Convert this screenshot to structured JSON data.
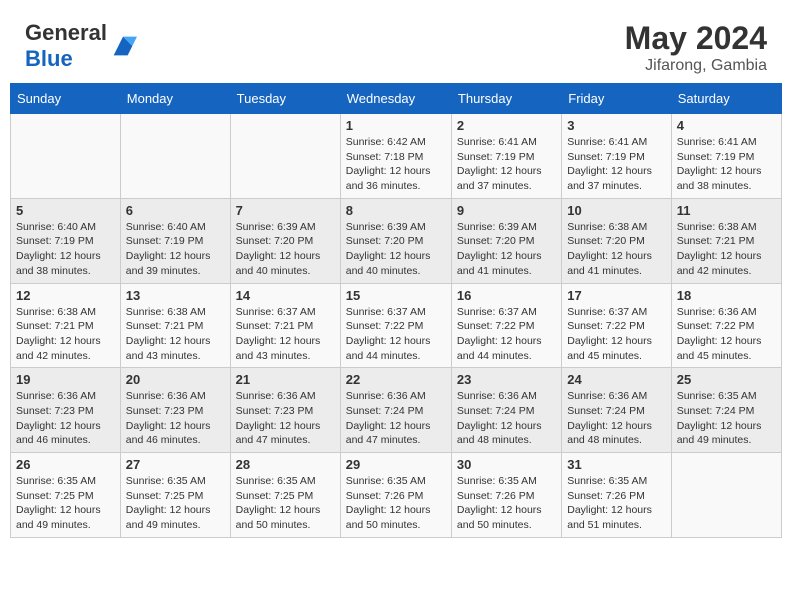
{
  "header": {
    "logo_general": "General",
    "logo_blue": "Blue",
    "month_year": "May 2024",
    "location": "Jifarong, Gambia"
  },
  "days_of_week": [
    "Sunday",
    "Monday",
    "Tuesday",
    "Wednesday",
    "Thursday",
    "Friday",
    "Saturday"
  ],
  "weeks": [
    [
      {
        "day": "",
        "info": ""
      },
      {
        "day": "",
        "info": ""
      },
      {
        "day": "",
        "info": ""
      },
      {
        "day": "1",
        "info": "Sunrise: 6:42 AM\nSunset: 7:18 PM\nDaylight: 12 hours and 36 minutes."
      },
      {
        "day": "2",
        "info": "Sunrise: 6:41 AM\nSunset: 7:19 PM\nDaylight: 12 hours and 37 minutes."
      },
      {
        "day": "3",
        "info": "Sunrise: 6:41 AM\nSunset: 7:19 PM\nDaylight: 12 hours and 37 minutes."
      },
      {
        "day": "4",
        "info": "Sunrise: 6:41 AM\nSunset: 7:19 PM\nDaylight: 12 hours and 38 minutes."
      }
    ],
    [
      {
        "day": "5",
        "info": "Sunrise: 6:40 AM\nSunset: 7:19 PM\nDaylight: 12 hours and 38 minutes."
      },
      {
        "day": "6",
        "info": "Sunrise: 6:40 AM\nSunset: 7:19 PM\nDaylight: 12 hours and 39 minutes."
      },
      {
        "day": "7",
        "info": "Sunrise: 6:39 AM\nSunset: 7:20 PM\nDaylight: 12 hours and 40 minutes."
      },
      {
        "day": "8",
        "info": "Sunrise: 6:39 AM\nSunset: 7:20 PM\nDaylight: 12 hours and 40 minutes."
      },
      {
        "day": "9",
        "info": "Sunrise: 6:39 AM\nSunset: 7:20 PM\nDaylight: 12 hours and 41 minutes."
      },
      {
        "day": "10",
        "info": "Sunrise: 6:38 AM\nSunset: 7:20 PM\nDaylight: 12 hours and 41 minutes."
      },
      {
        "day": "11",
        "info": "Sunrise: 6:38 AM\nSunset: 7:21 PM\nDaylight: 12 hours and 42 minutes."
      }
    ],
    [
      {
        "day": "12",
        "info": "Sunrise: 6:38 AM\nSunset: 7:21 PM\nDaylight: 12 hours and 42 minutes."
      },
      {
        "day": "13",
        "info": "Sunrise: 6:38 AM\nSunset: 7:21 PM\nDaylight: 12 hours and 43 minutes."
      },
      {
        "day": "14",
        "info": "Sunrise: 6:37 AM\nSunset: 7:21 PM\nDaylight: 12 hours and 43 minutes."
      },
      {
        "day": "15",
        "info": "Sunrise: 6:37 AM\nSunset: 7:22 PM\nDaylight: 12 hours and 44 minutes."
      },
      {
        "day": "16",
        "info": "Sunrise: 6:37 AM\nSunset: 7:22 PM\nDaylight: 12 hours and 44 minutes."
      },
      {
        "day": "17",
        "info": "Sunrise: 6:37 AM\nSunset: 7:22 PM\nDaylight: 12 hours and 45 minutes."
      },
      {
        "day": "18",
        "info": "Sunrise: 6:36 AM\nSunset: 7:22 PM\nDaylight: 12 hours and 45 minutes."
      }
    ],
    [
      {
        "day": "19",
        "info": "Sunrise: 6:36 AM\nSunset: 7:23 PM\nDaylight: 12 hours and 46 minutes."
      },
      {
        "day": "20",
        "info": "Sunrise: 6:36 AM\nSunset: 7:23 PM\nDaylight: 12 hours and 46 minutes."
      },
      {
        "day": "21",
        "info": "Sunrise: 6:36 AM\nSunset: 7:23 PM\nDaylight: 12 hours and 47 minutes."
      },
      {
        "day": "22",
        "info": "Sunrise: 6:36 AM\nSunset: 7:24 PM\nDaylight: 12 hours and 47 minutes."
      },
      {
        "day": "23",
        "info": "Sunrise: 6:36 AM\nSunset: 7:24 PM\nDaylight: 12 hours and 48 minutes."
      },
      {
        "day": "24",
        "info": "Sunrise: 6:36 AM\nSunset: 7:24 PM\nDaylight: 12 hours and 48 minutes."
      },
      {
        "day": "25",
        "info": "Sunrise: 6:35 AM\nSunset: 7:24 PM\nDaylight: 12 hours and 49 minutes."
      }
    ],
    [
      {
        "day": "26",
        "info": "Sunrise: 6:35 AM\nSunset: 7:25 PM\nDaylight: 12 hours and 49 minutes."
      },
      {
        "day": "27",
        "info": "Sunrise: 6:35 AM\nSunset: 7:25 PM\nDaylight: 12 hours and 49 minutes."
      },
      {
        "day": "28",
        "info": "Sunrise: 6:35 AM\nSunset: 7:25 PM\nDaylight: 12 hours and 50 minutes."
      },
      {
        "day": "29",
        "info": "Sunrise: 6:35 AM\nSunset: 7:26 PM\nDaylight: 12 hours and 50 minutes."
      },
      {
        "day": "30",
        "info": "Sunrise: 6:35 AM\nSunset: 7:26 PM\nDaylight: 12 hours and 50 minutes."
      },
      {
        "day": "31",
        "info": "Sunrise: 6:35 AM\nSunset: 7:26 PM\nDaylight: 12 hours and 51 minutes."
      },
      {
        "day": "",
        "info": ""
      }
    ]
  ]
}
